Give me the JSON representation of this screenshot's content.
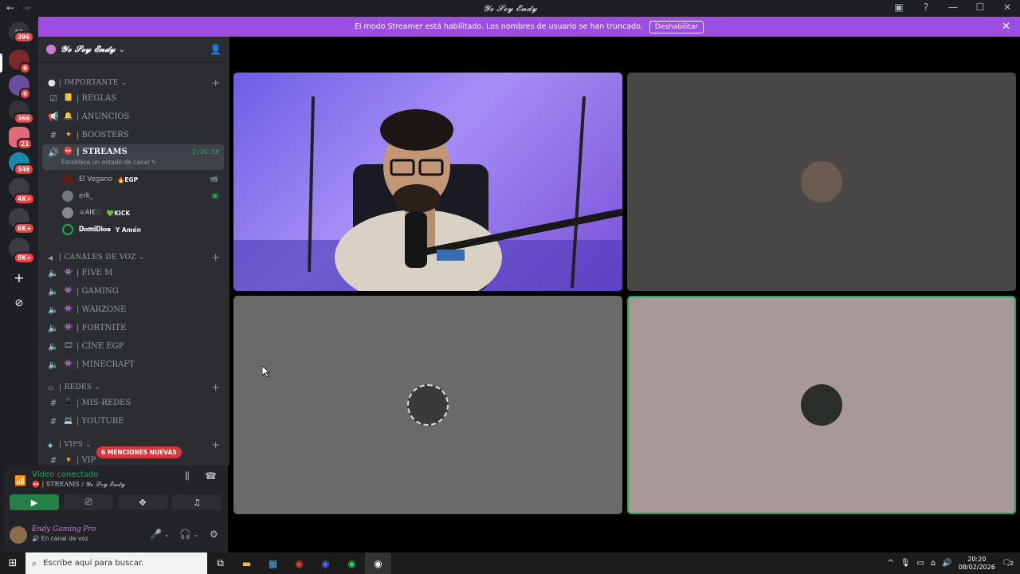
{
  "window": {
    "title": "𝓨𝓸 𝓢𝓸𝔂 𝓔𝓷𝓭𝔂",
    "nav_back": "←",
    "nav_fwd": "→",
    "controls": [
      "▣",
      "?",
      "—",
      "☐",
      "✕"
    ]
  },
  "banner": {
    "text": "El modo Streamer está habilitado. Los nombres de usuario se han truncado.",
    "button": "Deshabilitar",
    "close": "✕"
  },
  "servers": {
    "badges": [
      "396",
      "6",
      "6",
      "366",
      "21",
      "346",
      "4K+",
      "8K+",
      "9K+"
    ],
    "add": "+",
    "explore": "⊘"
  },
  "sidebar": {
    "server_name": "𝓨𝓸 𝓢𝓸𝔂 𝓔𝓷𝓭𝔂",
    "chevron": "⌄",
    "categories": {
      "importante": "| IMPORTANTE ⌄",
      "voz": "| CANALES DE VOZ ⌄",
      "redes": "| REDES ⌄",
      "vips": "| VIPS ⌄"
    },
    "channels": {
      "reglas": "| REGLAS",
      "anuncios": "| ANUNCIOS",
      "boosters": "| BOOSTERS",
      "streams": "| STREAMS",
      "streams_timer": "2:26:58",
      "streams_status": "Establece un estado de canal ✎",
      "fivem": "| FIVE M",
      "gaming": "| GAMING",
      "warzone": "| WARZONE",
      "fortnite": "| FORTNITE",
      "cine": "| CINE EGP",
      "minecraft": "| MINECRAFT",
      "misredes": "| MIS-REDES",
      "youtube": "| YOUTUBE",
      "vip": "| VIP"
    },
    "voice_users": [
      {
        "name": "El Vegano",
        "tag": "🔥EGP"
      },
      {
        "name": "erk_",
        "tag": ""
      },
      {
        "name": "♕Ał€♡",
        "tag": "💚KICK"
      },
      {
        "name": "𝐃𝐨𝐦𝐢𝐃𝐢𝐨𝐬",
        "tag": "Y Amén"
      }
    ],
    "mentions": "6 MENCIONES NUEVAS"
  },
  "voice": {
    "status": "Vídeo conectado",
    "channel": "⛔ | STREAMS / 𝓨𝓸 𝓢𝓸𝔂 𝓔𝓷𝓭𝔂"
  },
  "user": {
    "name": "Endy Gaming Pro",
    "status": "🔊 En canal de voz"
  },
  "taskbar": {
    "search_placeholder": "Escribe aquí para buscar.",
    "time": "20:20",
    "date": "08/02/2026",
    "notif": "2"
  }
}
